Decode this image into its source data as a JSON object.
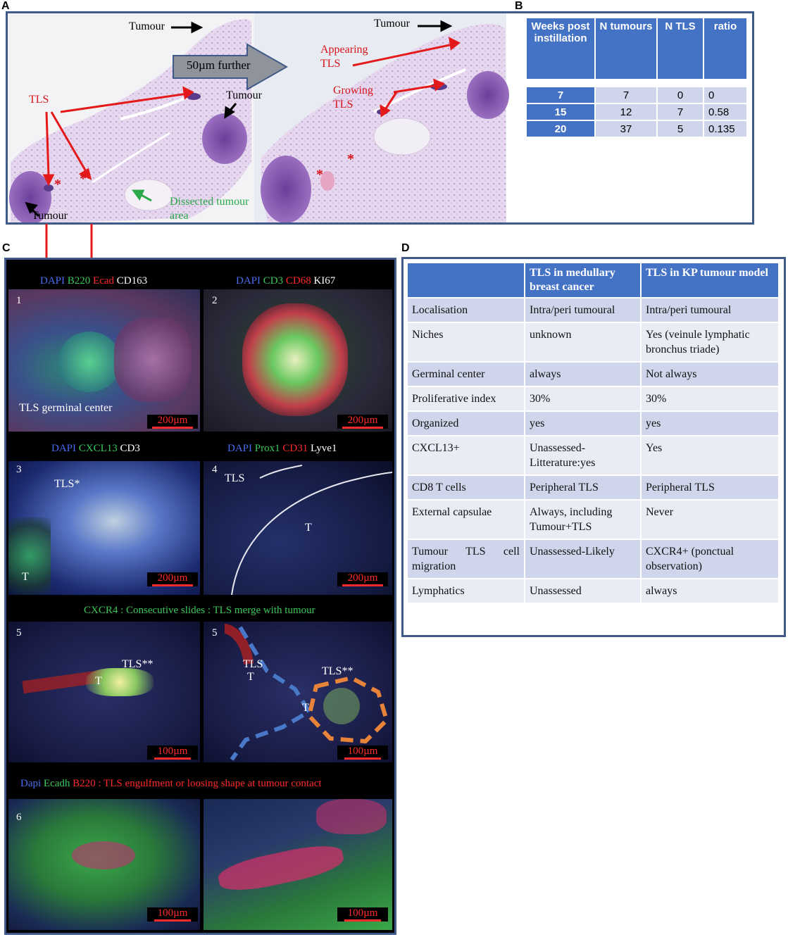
{
  "panels": {
    "a": "A",
    "b": "B",
    "c": "C",
    "d": "D"
  },
  "panel_a": {
    "tumour_top_left": "Tumour",
    "tumour_mid": "Tumour",
    "tumour_bottom": "Tumour",
    "tumour_top_right": "Tumour",
    "shift_label": "50µm further",
    "tls": "TLS",
    "appearing_tls": [
      "Appearing",
      "TLS"
    ],
    "growing_tls": [
      "Growing",
      "TLS"
    ],
    "dissected": [
      "Dissected tumour",
      "area"
    ],
    "asterisk": "*"
  },
  "panel_b": {
    "headers": [
      "Weeks post instillation",
      "N tumours",
      "N TLS",
      "ratio"
    ],
    "rows": [
      {
        "weeks": "7",
        "n_tumours": "7",
        "n_tls": "0",
        "ratio": "0"
      },
      {
        "weeks": "15",
        "n_tumours": "12",
        "n_tls": "7",
        "ratio": "0.58"
      },
      {
        "weeks": "20",
        "n_tumours": "37",
        "n_tls": "5",
        "ratio": "0.135"
      }
    ]
  },
  "panel_c": {
    "row1_left_title": {
      "dapi": "DAPI",
      "b220": "B220",
      "ecad": "Ecad",
      "cd163": "CD163"
    },
    "row1_right_title": {
      "dapi": "DAPI",
      "cd3": "CD3",
      "cd68": "CD68",
      "ki67": "KI67"
    },
    "row2_left_title": {
      "dapi": "DAPI",
      "cxcl13": "CXCL13",
      "cd3": "CD3"
    },
    "row2_right_title": {
      "dapi": "DAPI",
      "prox1": "Prox1",
      "cd31": "CD31",
      "lyve1": "Lyve1"
    },
    "row3_title": "CXCR4 : Consecutive slides : TLS merge with tumour",
    "row4_title": {
      "dapi": "Dapi",
      "ecadh": "Ecadh",
      "b220": "B220 : TLS engulfment or loosing shape at tumour contact"
    },
    "num1": "1",
    "num2": "2",
    "num3": "3",
    "num4": "4",
    "num5a": "5",
    "num5b": "5",
    "num6": "6",
    "tls_germinal": "TLS germinal center",
    "tls_star": "TLS*",
    "t": "T",
    "tls": "TLS",
    "tls_double_star": "TLS**",
    "scale_200": "200µm",
    "scale_100": "100µm"
  },
  "panel_d": {
    "headers": [
      "",
      "TLS in medullary breast cancer",
      "TLS in KP tumour model"
    ],
    "rows": [
      {
        "feature": "Localisation",
        "breast": "Intra/peri tumoural",
        "kp": "Intra/peri tumoural"
      },
      {
        "feature": "Niches",
        "breast": "unknown",
        "kp": "Yes (veinule lymphatic bronchus triade)"
      },
      {
        "feature": "Germinal center",
        "breast": "always",
        "kp": "Not always"
      },
      {
        "feature": "Proliferative index",
        "breast": "30%",
        "kp": "30%"
      },
      {
        "feature": "Organized",
        "breast": "yes",
        "kp": "yes"
      },
      {
        "feature": "CXCL13+",
        "breast": "Unassessed-Litterature:yes",
        "kp": "Yes"
      },
      {
        "feature": "CD8 T cells",
        "breast": "Peripheral TLS",
        "kp": "Peripheral TLS"
      },
      {
        "feature": "External capsulae",
        "breast": "Always, including Tumour+TLS",
        "kp": "Never"
      },
      {
        "feature": "Tumour TLS cell migration",
        "breast": "Unassessed-Likely",
        "kp": "CXCR4+ (ponctual observation)"
      },
      {
        "feature": "Lymphatics",
        "breast": "Unassessed",
        "kp": "always"
      }
    ]
  },
  "colors": {
    "frame": "#3f5a89",
    "table_header": "#4472c4",
    "row_dark": "#cfd5ea",
    "row_light": "#e9ebf5",
    "annotation_red": "#d8121a",
    "annotation_green": "#2aa84a",
    "dapi_blue": "#4a6cf0",
    "marker_green": "#3cc85a",
    "marker_red": "#ff2a2a"
  }
}
